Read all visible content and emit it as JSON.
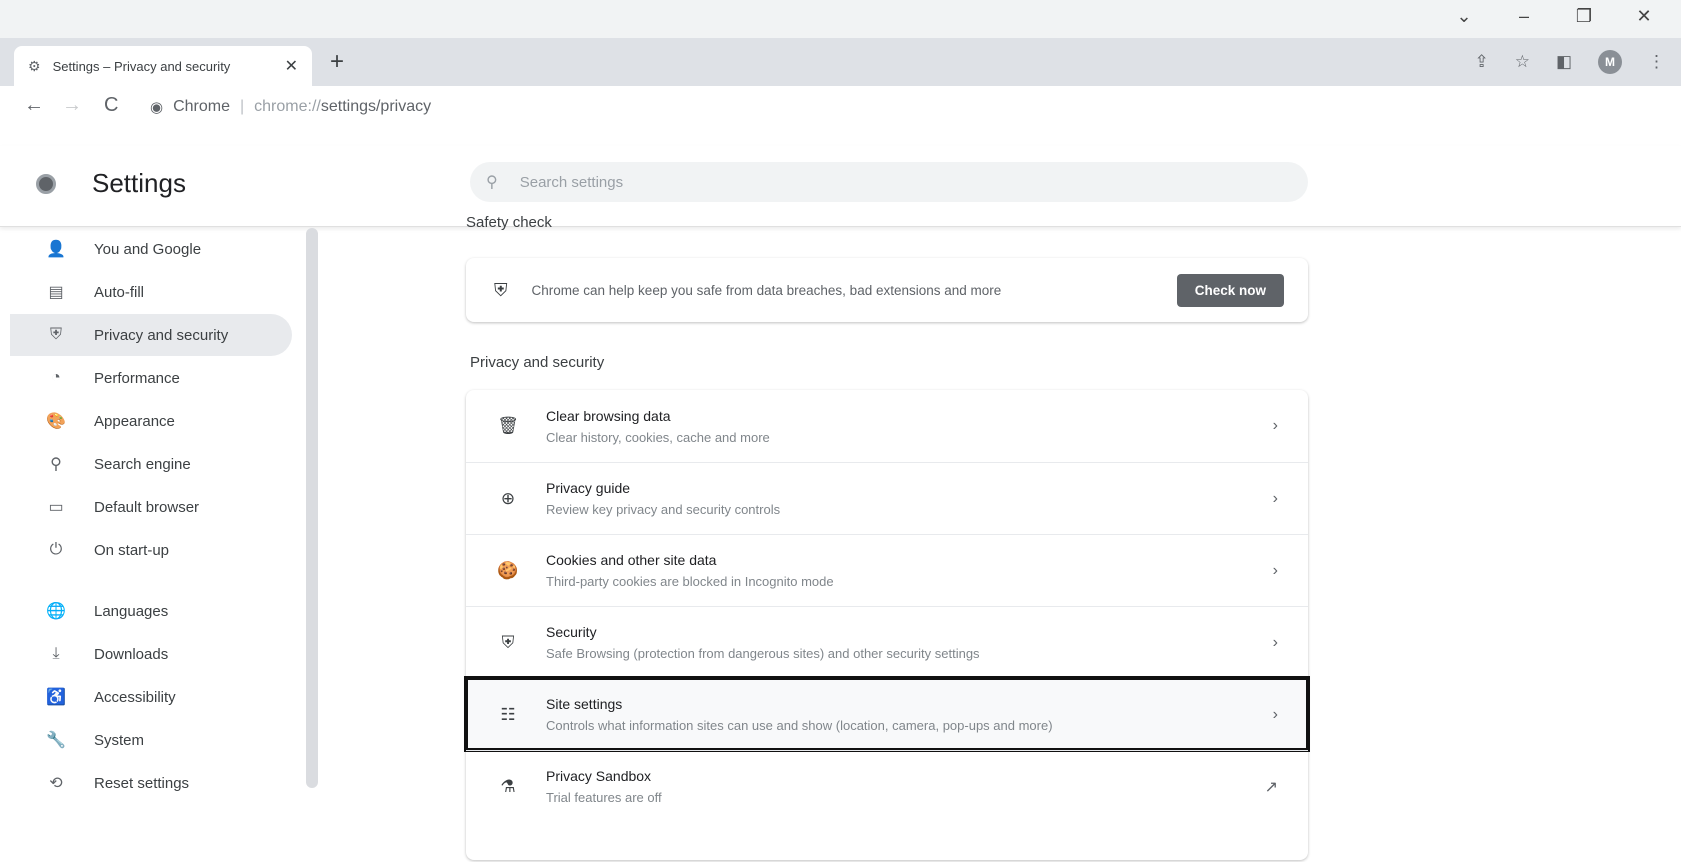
{
  "window": {
    "controls": [
      "⌄",
      "–",
      "❐",
      "✕"
    ]
  },
  "tab": {
    "title": "Settings – Privacy and security",
    "close": "✕",
    "new_tab": "+"
  },
  "navbar": {
    "back": "←",
    "forward": "→",
    "reload": "C",
    "site_label": "Chrome",
    "separator": "|",
    "url_scheme": "chrome://",
    "url_path": "settings/privacy"
  },
  "toolbar": {
    "share": "⇪",
    "bookmark": "☆",
    "sidepanel": "◧",
    "avatar": "M",
    "menu": "⋮"
  },
  "header": {
    "title": "Settings",
    "search_placeholder": "Search settings"
  },
  "sidebar": {
    "items": [
      {
        "label": "You and Google",
        "icon": "person-icon",
        "glyph": "👤"
      },
      {
        "label": "Auto-fill",
        "icon": "clipboard-icon",
        "glyph": "▤"
      },
      {
        "label": "Privacy and security",
        "icon": "shield-icon",
        "glyph": "⛨",
        "active": true
      },
      {
        "label": "Performance",
        "icon": "speedometer-icon",
        "glyph": "◔"
      },
      {
        "label": "Appearance",
        "icon": "palette-icon",
        "glyph": "🎨"
      },
      {
        "label": "Search engine",
        "icon": "search-icon",
        "glyph": "⚲"
      },
      {
        "label": "Default browser",
        "icon": "browser-icon",
        "glyph": "▭"
      },
      {
        "label": "On start-up",
        "icon": "power-icon",
        "glyph": "⏻"
      },
      {
        "label": "Languages",
        "icon": "globe-icon",
        "glyph": "🌐"
      },
      {
        "label": "Downloads",
        "icon": "download-icon",
        "glyph": "⤓"
      },
      {
        "label": "Accessibility",
        "icon": "accessibility-icon",
        "glyph": "♿"
      },
      {
        "label": "System",
        "icon": "wrench-icon",
        "glyph": "🔧"
      },
      {
        "label": "Reset settings",
        "icon": "reset-icon",
        "glyph": "⟲"
      }
    ]
  },
  "safety_check": {
    "section_title": "Safety check",
    "description": "Chrome can help keep you safe from data breaches, bad extensions and more",
    "button": "Check now"
  },
  "privacy": {
    "section_title": "Privacy and security",
    "rows": [
      {
        "title": "Clear browsing data",
        "subtitle": "Clear history, cookies, cache and more",
        "icon": "trash-icon",
        "glyph": "🗑",
        "action": "›"
      },
      {
        "title": "Privacy guide",
        "subtitle": "Review key privacy and security controls",
        "icon": "compass-icon",
        "glyph": "⊕",
        "action": "›"
      },
      {
        "title": "Cookies and other site data",
        "subtitle": "Third-party cookies are blocked in Incognito mode",
        "icon": "cookie-icon",
        "glyph": "🍪",
        "action": "›"
      },
      {
        "title": "Security",
        "subtitle": "Safe Browsing (protection from dangerous sites) and other security settings",
        "icon": "shield-icon",
        "glyph": "⛨",
        "action": "›"
      },
      {
        "title": "Site settings",
        "subtitle": "Controls what information sites can use and show (location, camera, pop-ups and more)",
        "icon": "sliders-icon",
        "glyph": "☷",
        "action": "›",
        "highlighted": true
      },
      {
        "title": "Privacy Sandbox",
        "subtitle": "Trial features are off",
        "icon": "flask-icon",
        "glyph": "⚗",
        "action": "↗"
      }
    ]
  }
}
